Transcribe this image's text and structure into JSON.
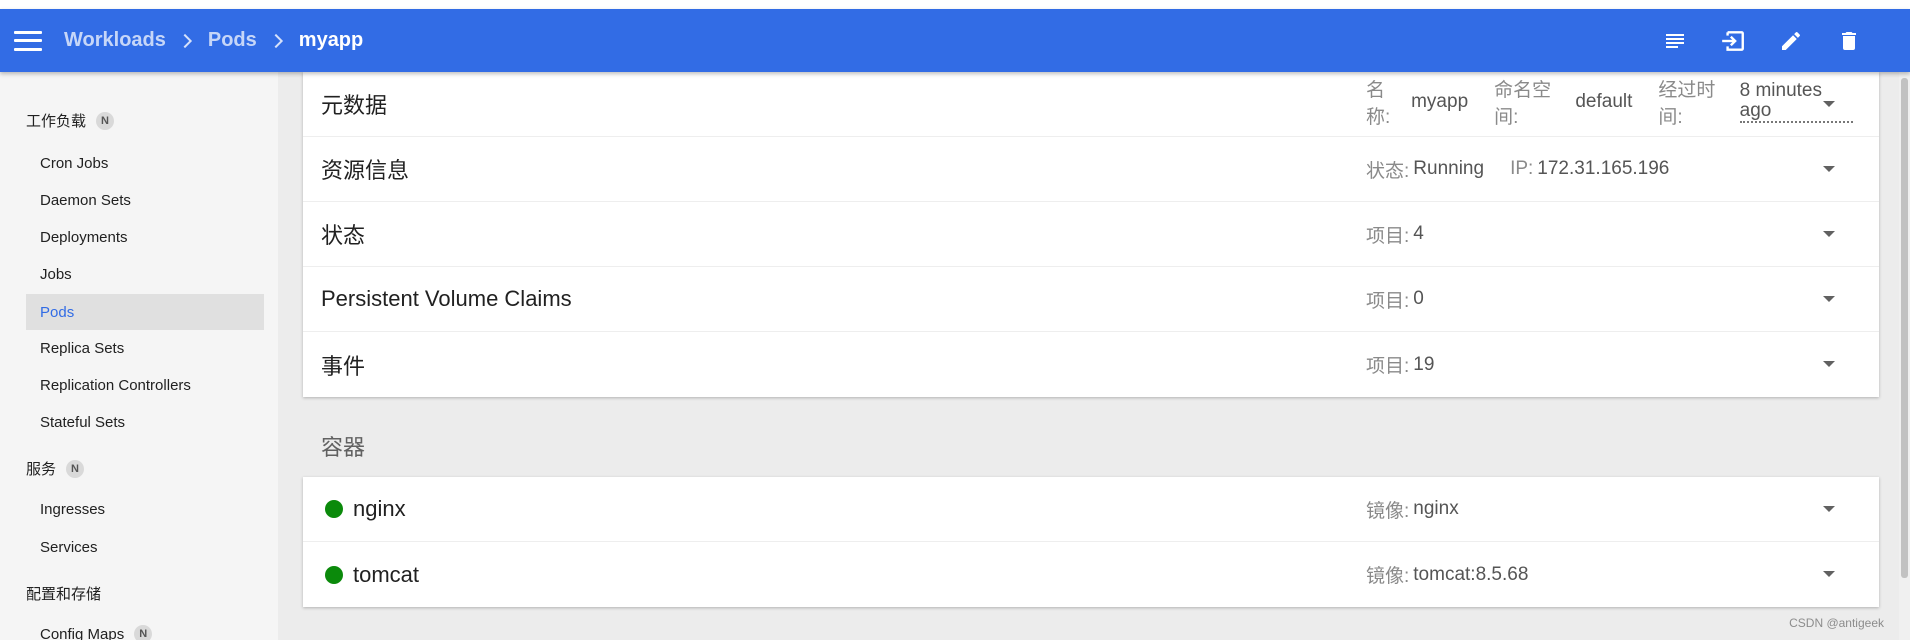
{
  "header": {
    "breadcrumbs": [
      "Workloads",
      "Pods",
      "myapp"
    ],
    "actions": [
      "logs-icon",
      "exec-icon",
      "edit-icon",
      "delete-icon"
    ]
  },
  "sidebar": {
    "sections": [
      {
        "label": "工作负载",
        "badge": "N"
      },
      {
        "label": "服务",
        "badge": "N"
      },
      {
        "label": "配置和存储",
        "badge": ""
      }
    ],
    "workload_items": [
      "Cron Jobs",
      "Daemon Sets",
      "Deployments",
      "Jobs",
      "Pods",
      "Replica Sets",
      "Replication Controllers",
      "Stateful Sets"
    ],
    "service_items": [
      "Ingresses",
      "Services"
    ],
    "config_items": [
      {
        "label": "Config Maps",
        "badge": "N"
      }
    ],
    "active_item": "Pods"
  },
  "details": [
    {
      "title": "元数据",
      "meta": [
        {
          "key": "名称:",
          "value": "myapp"
        },
        {
          "key": "命名空间:",
          "value": "default"
        },
        {
          "key": "经过时间:",
          "value": "8 minutes ago"
        }
      ]
    },
    {
      "title": "资源信息",
      "meta": [
        {
          "key": "状态:",
          "value": "Running"
        },
        {
          "key": "IP:",
          "value": "172.31.165.196"
        }
      ]
    },
    {
      "title": "状态",
      "meta": [
        {
          "key": "项目:",
          "value": "4"
        }
      ]
    },
    {
      "title": "Persistent Volume Claims",
      "meta": [
        {
          "key": "项目:",
          "value": "0"
        }
      ]
    },
    {
      "title": "事件",
      "meta": [
        {
          "key": "项目:",
          "value": "19"
        }
      ]
    }
  ],
  "containers_title": "容器",
  "containers": [
    {
      "name": "nginx",
      "image_key": "镜像:",
      "image": "nginx"
    },
    {
      "name": "tomcat",
      "image_key": "镜像:",
      "image": "tomcat:8.5.68"
    }
  ],
  "colors": {
    "primary": "#326ce5",
    "running": "#0b8a0b"
  },
  "watermark": "CSDN @antigeek"
}
